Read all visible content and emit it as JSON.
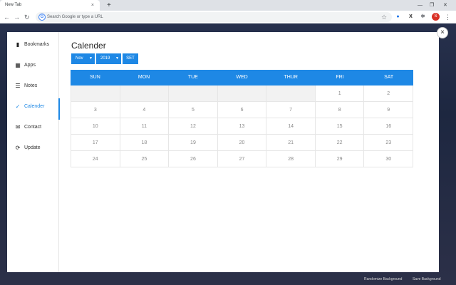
{
  "browser": {
    "tab_title": "New Tab",
    "tab_close": "×",
    "new_tab": "+",
    "omnibox_placeholder": "Search Google or type a URL",
    "profile_initial": "S",
    "window_minimize": "—",
    "window_restore": "❐",
    "window_close": "✕"
  },
  "sidebar": {
    "items": [
      {
        "label": "Bookmarks",
        "icon": "bookmark-icon",
        "glyph": "▮"
      },
      {
        "label": "Apps",
        "icon": "apps-grid-icon",
        "glyph": "▦"
      },
      {
        "label": "Notes",
        "icon": "notes-icon",
        "glyph": "☰"
      },
      {
        "label": "Calender",
        "icon": "calendar-check-icon",
        "glyph": "✓"
      },
      {
        "label": "Contact",
        "icon": "mail-icon",
        "glyph": "✉"
      },
      {
        "label": "Update",
        "icon": "refresh-icon",
        "glyph": "⟳"
      }
    ],
    "active_index": 3
  },
  "calendar": {
    "title": "Calender",
    "month": "Nov",
    "year": "2019",
    "set_label": "SET",
    "weekdays": [
      "SUN",
      "MON",
      "TUE",
      "WED",
      "THUR",
      "FRI",
      "SAT"
    ],
    "weeks": [
      [
        "",
        "",
        "",
        "",
        "",
        "1",
        "2"
      ],
      [
        "3",
        "4",
        "5",
        "6",
        "7",
        "8",
        "9"
      ],
      [
        "10",
        "11",
        "12",
        "13",
        "14",
        "15",
        "16"
      ],
      [
        "17",
        "18",
        "19",
        "20",
        "21",
        "22",
        "23"
      ],
      [
        "24",
        "25",
        "26",
        "27",
        "28",
        "29",
        "30"
      ]
    ]
  },
  "footer": {
    "randomize": "Randomize Background",
    "save": "Save Background"
  },
  "colors": {
    "accent": "#1e88e5",
    "profile": "#d93025"
  }
}
